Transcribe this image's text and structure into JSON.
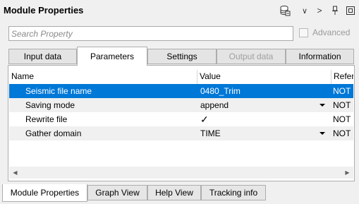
{
  "header": {
    "title": "Module Properties"
  },
  "toolbar_icons": [
    {
      "name": "database-icon",
      "glyph": ""
    },
    {
      "name": "chevron-down-icon",
      "glyph": "∨"
    },
    {
      "name": "chevron-right-icon",
      "glyph": ">"
    },
    {
      "name": "pin-icon",
      "glyph": ""
    },
    {
      "name": "window-icon",
      "glyph": ""
    }
  ],
  "search": {
    "placeholder": "Search Property"
  },
  "advanced": {
    "label": "Advanced",
    "checked": false
  },
  "tabs": [
    {
      "label": "Input data",
      "state": "normal"
    },
    {
      "label": "Parameters",
      "state": "active"
    },
    {
      "label": "Settings",
      "state": "normal"
    },
    {
      "label": "Output data",
      "state": "disabled"
    },
    {
      "label": "Information",
      "state": "normal"
    }
  ],
  "grid": {
    "columns": [
      "Name",
      "Value",
      "Refere"
    ],
    "rows": [
      {
        "name": "Seismic file name",
        "value": "0480_Trim",
        "ref": "NOT S",
        "selected": true,
        "dropdown": false
      },
      {
        "name": "Saving mode",
        "value": "append",
        "ref": "NOT S",
        "selected": false,
        "dropdown": true
      },
      {
        "name": "Rewrite file",
        "value": "✓",
        "ref": "NOT S",
        "selected": false,
        "dropdown": false
      },
      {
        "name": "Gather domain",
        "value": "TIME",
        "ref": "NOT S",
        "selected": false,
        "dropdown": true
      }
    ]
  },
  "bottom_tabs": [
    {
      "label": "Module Properties",
      "active": true
    },
    {
      "label": "Graph View",
      "active": false
    },
    {
      "label": "Help View",
      "active": false
    },
    {
      "label": "Tracking info",
      "active": false
    }
  ]
}
